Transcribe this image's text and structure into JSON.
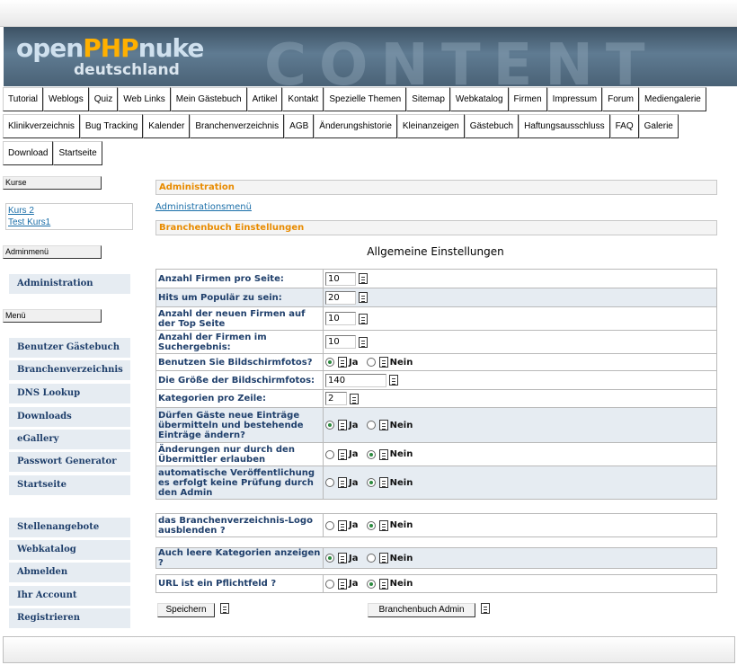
{
  "banner": {
    "logo_open": "open",
    "logo_php": "PHP",
    "logo_nuke": "nuke",
    "logo_sub": "deutschland",
    "ghost_text": "CONTENT"
  },
  "nav": {
    "row1": [
      "Tutorial",
      "Weblogs",
      "Quiz",
      "Web Links",
      "Mein Gästebuch",
      "Artikel",
      "Kontakt",
      "Spezielle Themen",
      "Sitemap",
      "Webkatalog",
      "Firmen",
      "Impressum",
      "Forum",
      "Mediengalerie"
    ],
    "row2": [
      "Klinikverzeichnis",
      "Bug Tracking",
      "Kalender",
      "Branchenverzeichnis",
      "AGB",
      "Änderungshistorie",
      "Kleinanzeigen",
      "Gästebuch",
      "Haftungsausschluss",
      "FAQ",
      "Galerie"
    ],
    "row3": [
      "Download",
      "Startseite"
    ]
  },
  "sidebar": {
    "kurse_label": "Kurse",
    "kurse": [
      "Kurs 2",
      "Test Kurs1"
    ],
    "adminmenu_label": "Adminmenü",
    "admin_item": "Administration",
    "menu_label": "Menü",
    "menu_items": [
      "Benutzer Gästebuch",
      "Branchenverzeichnis",
      "DNS Lookup",
      "Downloads",
      "eGallery",
      "Passwort Generator",
      "Startseite"
    ],
    "menu_items2": [
      "Stellenangebote",
      "Webkatalog",
      "Abmelden",
      "Ihr Account",
      "Registrieren"
    ]
  },
  "main": {
    "admin_header": "Administration",
    "admin_link": "Administrationsmenü",
    "branchen_header": "Branchenbuch Einstellungen",
    "section_title": "Allgemeine Einstellungen",
    "yes": "Ja",
    "no": "Nein",
    "fields": [
      {
        "label": "Anzahl Firmen pro Seite:",
        "type": "text",
        "value": "10"
      },
      {
        "label": "Hits um Populär zu sein:",
        "type": "text",
        "value": "20"
      },
      {
        "label": "Anzahl der neuen Firmen auf der Top Seite",
        "type": "text",
        "value": "10"
      },
      {
        "label": "Anzahl der Firmen im Suchergebnis:",
        "type": "text",
        "value": "10"
      },
      {
        "label": "Benutzen Sie Bildschirmfotos?",
        "type": "radio",
        "value": "Ja"
      },
      {
        "label": "Die Größe der Bildschirmfotos:",
        "type": "text",
        "value": "140"
      },
      {
        "label": "Kategorien pro Zeile:",
        "type": "text",
        "value": "2"
      },
      {
        "label": "Dürfen Gäste neue Einträge übermitteln und bestehende Einträge ändern?",
        "type": "radio",
        "value": "Ja"
      },
      {
        "label": "Änderungen nur durch den Übermittler erlauben",
        "type": "radio",
        "value": "Nein"
      },
      {
        "label": "automatische Veröffentlichung es erfolgt keine Prüfung durch den Admin",
        "type": "radio",
        "value": "Nein"
      }
    ],
    "extra_fields": [
      {
        "label": "das Branchenverzeichnis-Logo ausblenden ?",
        "value": "Nein"
      },
      {
        "label": "Auch leere Kategorien anzeigen ?",
        "value": "Ja"
      },
      {
        "label": "URL ist ein Pflichtfeld ?",
        "value": "Nein"
      }
    ],
    "save_button": "Speichern",
    "admin_button": "Branchenbuch Admin"
  }
}
